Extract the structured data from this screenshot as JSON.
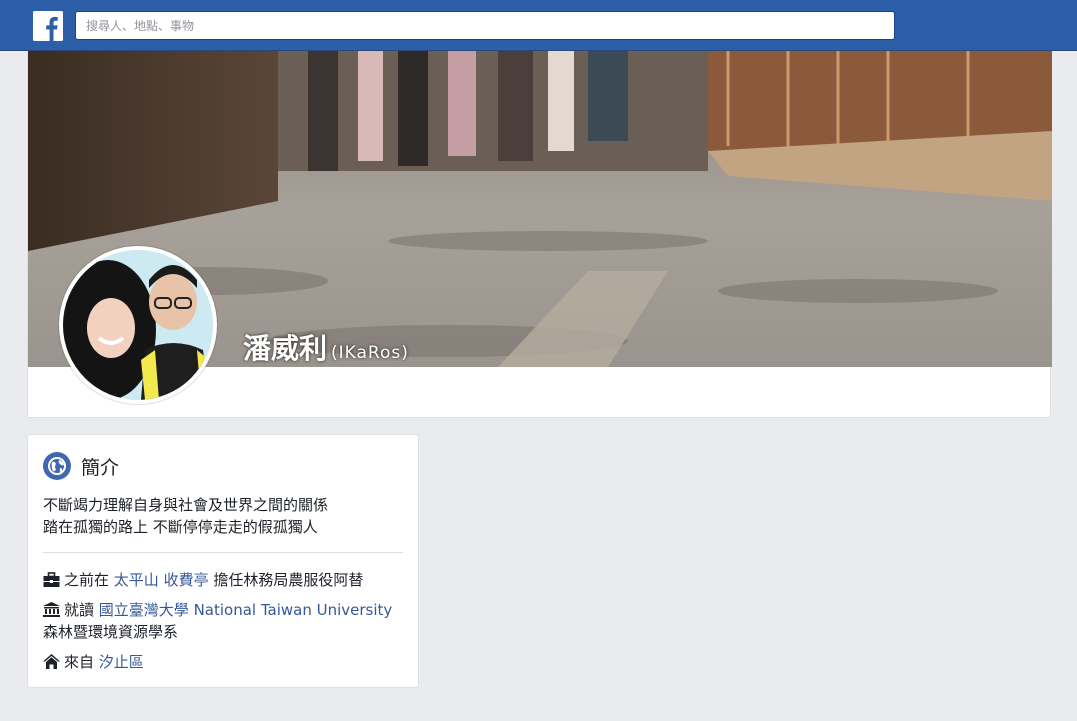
{
  "topbar": {
    "logo_letter": "f",
    "search_placeholder": "搜尋人、地點、事物"
  },
  "profile": {
    "name": "潘威利",
    "alternate_name": "(IKaRos)"
  },
  "intro": {
    "title": "簡介",
    "bio_lines": [
      "不斷竭力理解自身與社會及世界之間的關係",
      "踏在孤獨的路上 不斷停停走走的假孤獨人"
    ],
    "work": {
      "prefix": "之前在",
      "place": "太平山 收費亭",
      "suffix": "擔任林務局農服役阿替"
    },
    "education": {
      "prefix": "就讀",
      "school": "國立臺灣大學 National Taiwan University",
      "department": "森林暨環境資源學系"
    },
    "hometown": {
      "prefix": "來自",
      "place": "汐止區"
    }
  },
  "colors": {
    "topbar": "#2d5fa8",
    "link": "#365899",
    "background": "#e9ebee",
    "intro_icon": "#4267b2"
  },
  "icons": [
    "facebook-logo-icon",
    "globe-icon",
    "briefcase-icon",
    "university-icon",
    "home-icon"
  ]
}
